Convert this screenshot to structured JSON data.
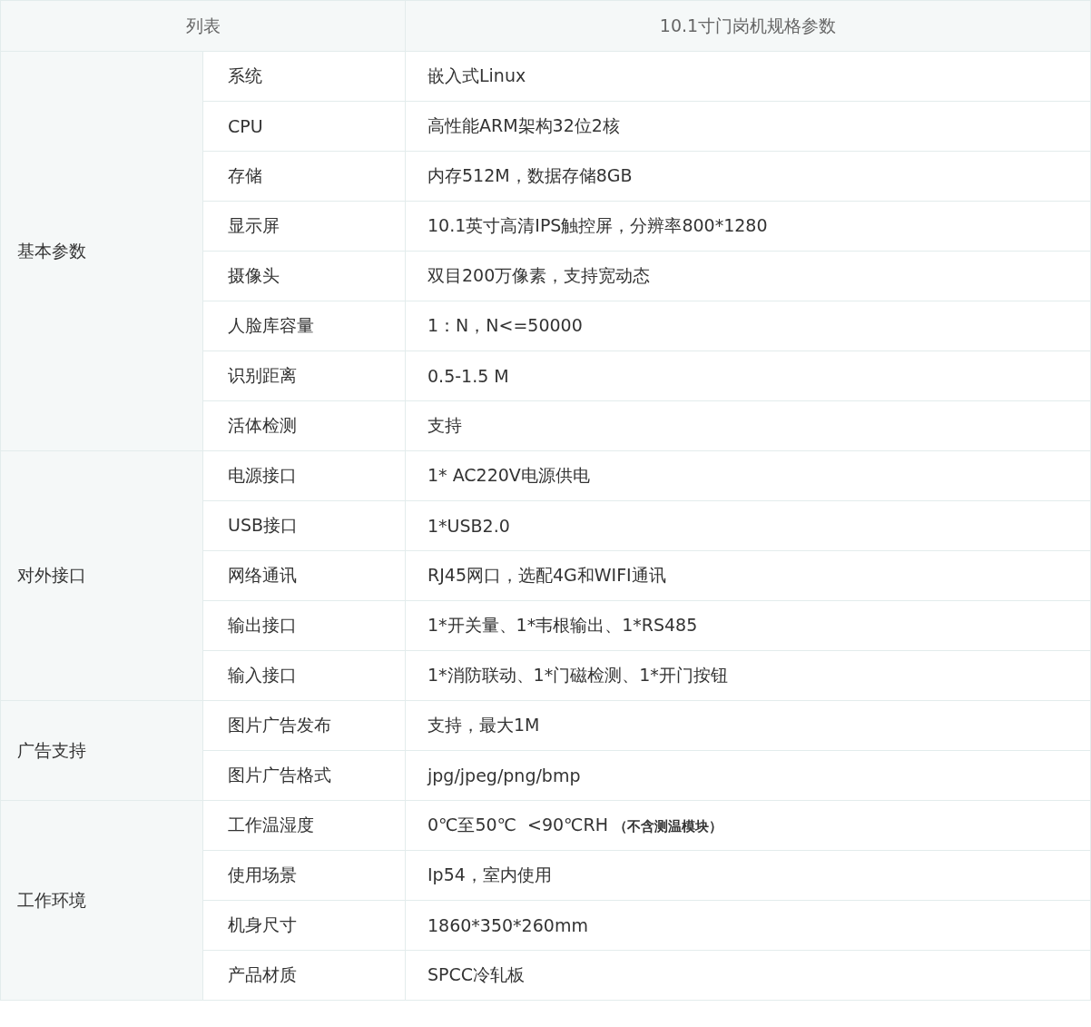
{
  "table": {
    "columns": [
      "列表",
      "10.1寸门岗机规格参数"
    ],
    "groups": [
      {
        "name": "基本参数",
        "rows": [
          {
            "label": "系统",
            "value": "嵌入式Linux"
          },
          {
            "label": "CPU",
            "value": "高性能ARM架构32位2核"
          },
          {
            "label": "存储",
            "value": "内存512M，数据存储8GB"
          },
          {
            "label": "显示屏",
            "value": "10.1英寸高清IPS触控屏，分辨率800*1280"
          },
          {
            "label": "摄像头",
            "value": "双目200万像素，支持宽动态"
          },
          {
            "label": "人脸库容量",
            "value": "1：N，N<=50000"
          },
          {
            "label": "识别距离",
            "value": "0.5-1.5 M"
          },
          {
            "label": "活体检测",
            "value": "支持"
          }
        ]
      },
      {
        "name": "对外接口",
        "rows": [
          {
            "label": "电源接口",
            "value": "1* AC220V电源供电"
          },
          {
            "label": "USB接口",
            "value": "1*USB2.0"
          },
          {
            "label": "网络通讯",
            "value": "RJ45网口，选配4G和WIFI通讯"
          },
          {
            "label": "输出接口",
            "value": "1*开关量、1*韦根输出、1*RS485"
          },
          {
            "label": "输入接口",
            "value": "1*消防联动、1*门磁检测、1*开门按钮"
          }
        ]
      },
      {
        "name": "广告支持",
        "rows": [
          {
            "label": "图片广告发布",
            "value": "支持，最大1M"
          },
          {
            "label": "图片广告格式",
            "value": "jpg/jpeg/png/bmp"
          }
        ]
      },
      {
        "name": "工作环境",
        "rows": [
          {
            "label": "工作温湿度",
            "value": "0℃至50℃  <90℃RH",
            "note": "（不含测温模块）"
          },
          {
            "label": "使用场景",
            "value": "Ip54，室内使用"
          },
          {
            "label": "机身尺寸",
            "value": "1860*350*260mm"
          },
          {
            "label": "产品材质",
            "value": "SPCC冷轧板"
          }
        ]
      }
    ]
  }
}
